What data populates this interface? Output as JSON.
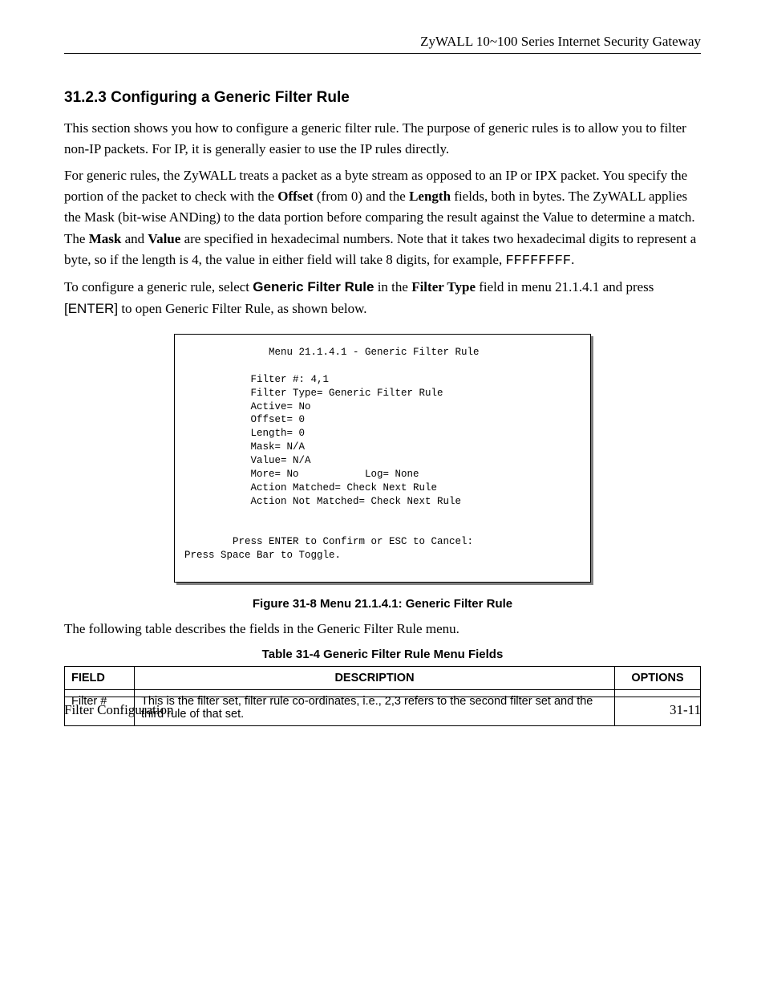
{
  "header": {
    "doc_title": "ZyWALL 10~100 Series Internet Security Gateway"
  },
  "section": {
    "number": "31.2.3",
    "title": "Configuring a Generic Filter Rule"
  },
  "para1_a": " This section shows you how to configure a generic filter rule. The purpose of generic rules is to allow you to filter non-IP packets. For IP, it is generally easier to use the IP rules directly.",
  "para2_a": "For generic rules, the ZyWALL treats a packet as a byte stream as opposed to an IP or IPX packet. You specify the portion of the packet to check with the ",
  "para2_offset": "Offset",
  "para2_b": " (from 0) and the ",
  "para2_length": "Length",
  "para2_c": " fields, both in bytes. The ZyWALL applies the Mask (bit-wise ANDing) to the data portion before comparing the result against the Value to determine a match. The ",
  "para2_mask": "Mask",
  "para2_d": " and ",
  "para2_value": "Value",
  "para2_e": " are specified in hexadecimal numbers. Note that it takes two hexadecimal digits to represent a byte, so if the length is 4, the value in either field will take 8 digits, for example, ",
  "para2_mono": "FFFFFFFF",
  "para2_f": ".",
  "para3_a": "To configure a generic rule, select ",
  "para3_gfr": "Generic Filter Rule",
  "para3_b": " in the ",
  "para3_ft": "Filter Type",
  "para3_c": " field in menu 21.1.4.1 and press ",
  "para3_enter": "[ENTER]",
  "para3_d": " to open Generic Filter Rule, as shown below.",
  "terminal": {
    "title_line": "              Menu 21.1.4.1 - Generic Filter Rule",
    "filter_num": "           Filter #: 4,1",
    "filter_type": "           Filter Type= Generic Filter Rule",
    "active": "           Active= No",
    "offset": "           Offset= 0",
    "length": "           Length= 0",
    "mask": "           Mask= N/A",
    "value": "           Value= N/A",
    "more_log": "           More= No           Log= None",
    "matched": "           Action Matched= Check Next Rule",
    "not_matched": "           Action Not Matched= Check Next Rule",
    "confirm": "        Press ENTER to Confirm or ESC to Cancel:",
    "toggle": "Press Space Bar to Toggle."
  },
  "figure_caption": "Figure 31-8 Menu 21.1.4.1: Generic Filter Rule",
  "table_intro": "The following table describes the fields in the Generic Filter Rule menu.",
  "table_caption": "Table 31-4 Generic Filter Rule Menu Fields",
  "table": {
    "headers": {
      "field": "FIELD",
      "description": "DESCRIPTION",
      "options": "OPTIONS"
    },
    "rows": [
      {
        "field": "Filter #",
        "description": "This is the filter set, filter rule co-ordinates, i.e., 2,3 refers to the second filter set and the third rule of that set.",
        "options": ""
      }
    ]
  },
  "footer": {
    "left": "Filter Configuration",
    "right": "31-11"
  }
}
